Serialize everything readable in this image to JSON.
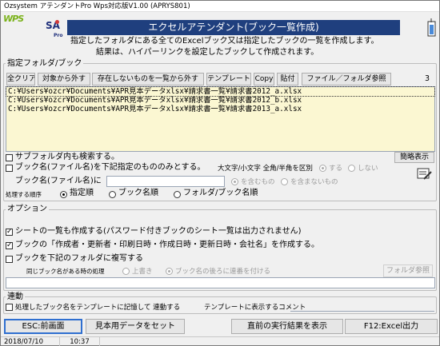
{
  "window": {
    "title": "Ozsystem アテンダントPro Wps対応版V1.00 (APRYS801)"
  },
  "logo": {
    "wps": "WPS",
    "sa": "SA",
    "sa_sub": "Pro"
  },
  "banner": "エクセルアテンダント(ブック一覧作成)",
  "description": {
    "line1": "指定したフォルダにある全てのExcelブック又は指定したブックの一覧を作成します。",
    "line2": "結果は、ハイパーリンクを設定したブックして作成されます。"
  },
  "folder_group": {
    "title": "指定フォルダ/ブック"
  },
  "toolbar": {
    "clear_all": "全クリア",
    "exclude": "対象から外す",
    "exclude_missing": "存在しないものを一覧から外す",
    "template": "テンプレート",
    "copy": "Copy",
    "paste": "貼付",
    "browse": "ファイル／フォルダ参照",
    "count": "3"
  },
  "files": [
    "C:¥Users¥ozcr¥Documents¥APR見本データxlsx¥請求書一覧¥請求書2012_a.xlsx",
    "C:¥Users¥ozcr¥Documents¥APR見本データxlsx¥請求書一覧¥請求書2012_b.xlsx",
    "C:¥Users¥ozcr¥Documents¥APR見本データxlsx¥請求書一覧¥請求書2013_a.xlsx"
  ],
  "search": {
    "subfolder_label": "サブフォルダ内も検索する。",
    "brief_button": "簡略表示",
    "bookname_filter_label": "ブック名(ファイル名)を下記指定のもののみとする。",
    "case_label": "大文字/小文字 全角/半角を区別",
    "case_yes": "する",
    "case_no": "しない",
    "bookname_input_label": "ブック名(ファイル名)に",
    "bookname_value": "",
    "contains": "を含むもの",
    "not_contains": "を含まないもの",
    "order_label": "処理する順序",
    "order_options": [
      "指定順",
      "ブック名順",
      "フォルダ/ブック名順"
    ]
  },
  "options": {
    "title": "オプション",
    "sheet_list": "シートの一覧も作成する(パスワード付きブックのシート一覧は出力されません)",
    "props": "ブックの「作成者・更新者・印刷日時・作成日時・更新日時・会社名」を作成する。",
    "copy_books": "ブックを下記のフォルダに複写する",
    "same_name_label": "同じブック名がある時の処理",
    "overwrite": "上書き",
    "serial": "ブック名の後ろに連番を付ける",
    "folder_ref": "フォルダ参照",
    "folder_value": ""
  },
  "link": {
    "title": "連動",
    "label": "処理したブック名をテンプレートに記憶して 連動する",
    "comment_label": "テンプレートに表示するコメント",
    "comment_value": ""
  },
  "bottom": {
    "esc": "ESC:前画面",
    "sample": "見本用データをセット",
    "prev_result": "直前の実行結果を表示",
    "f12": "F12:Excel出力"
  },
  "status": {
    "date": "2018/07/10",
    "time": "10:37"
  }
}
